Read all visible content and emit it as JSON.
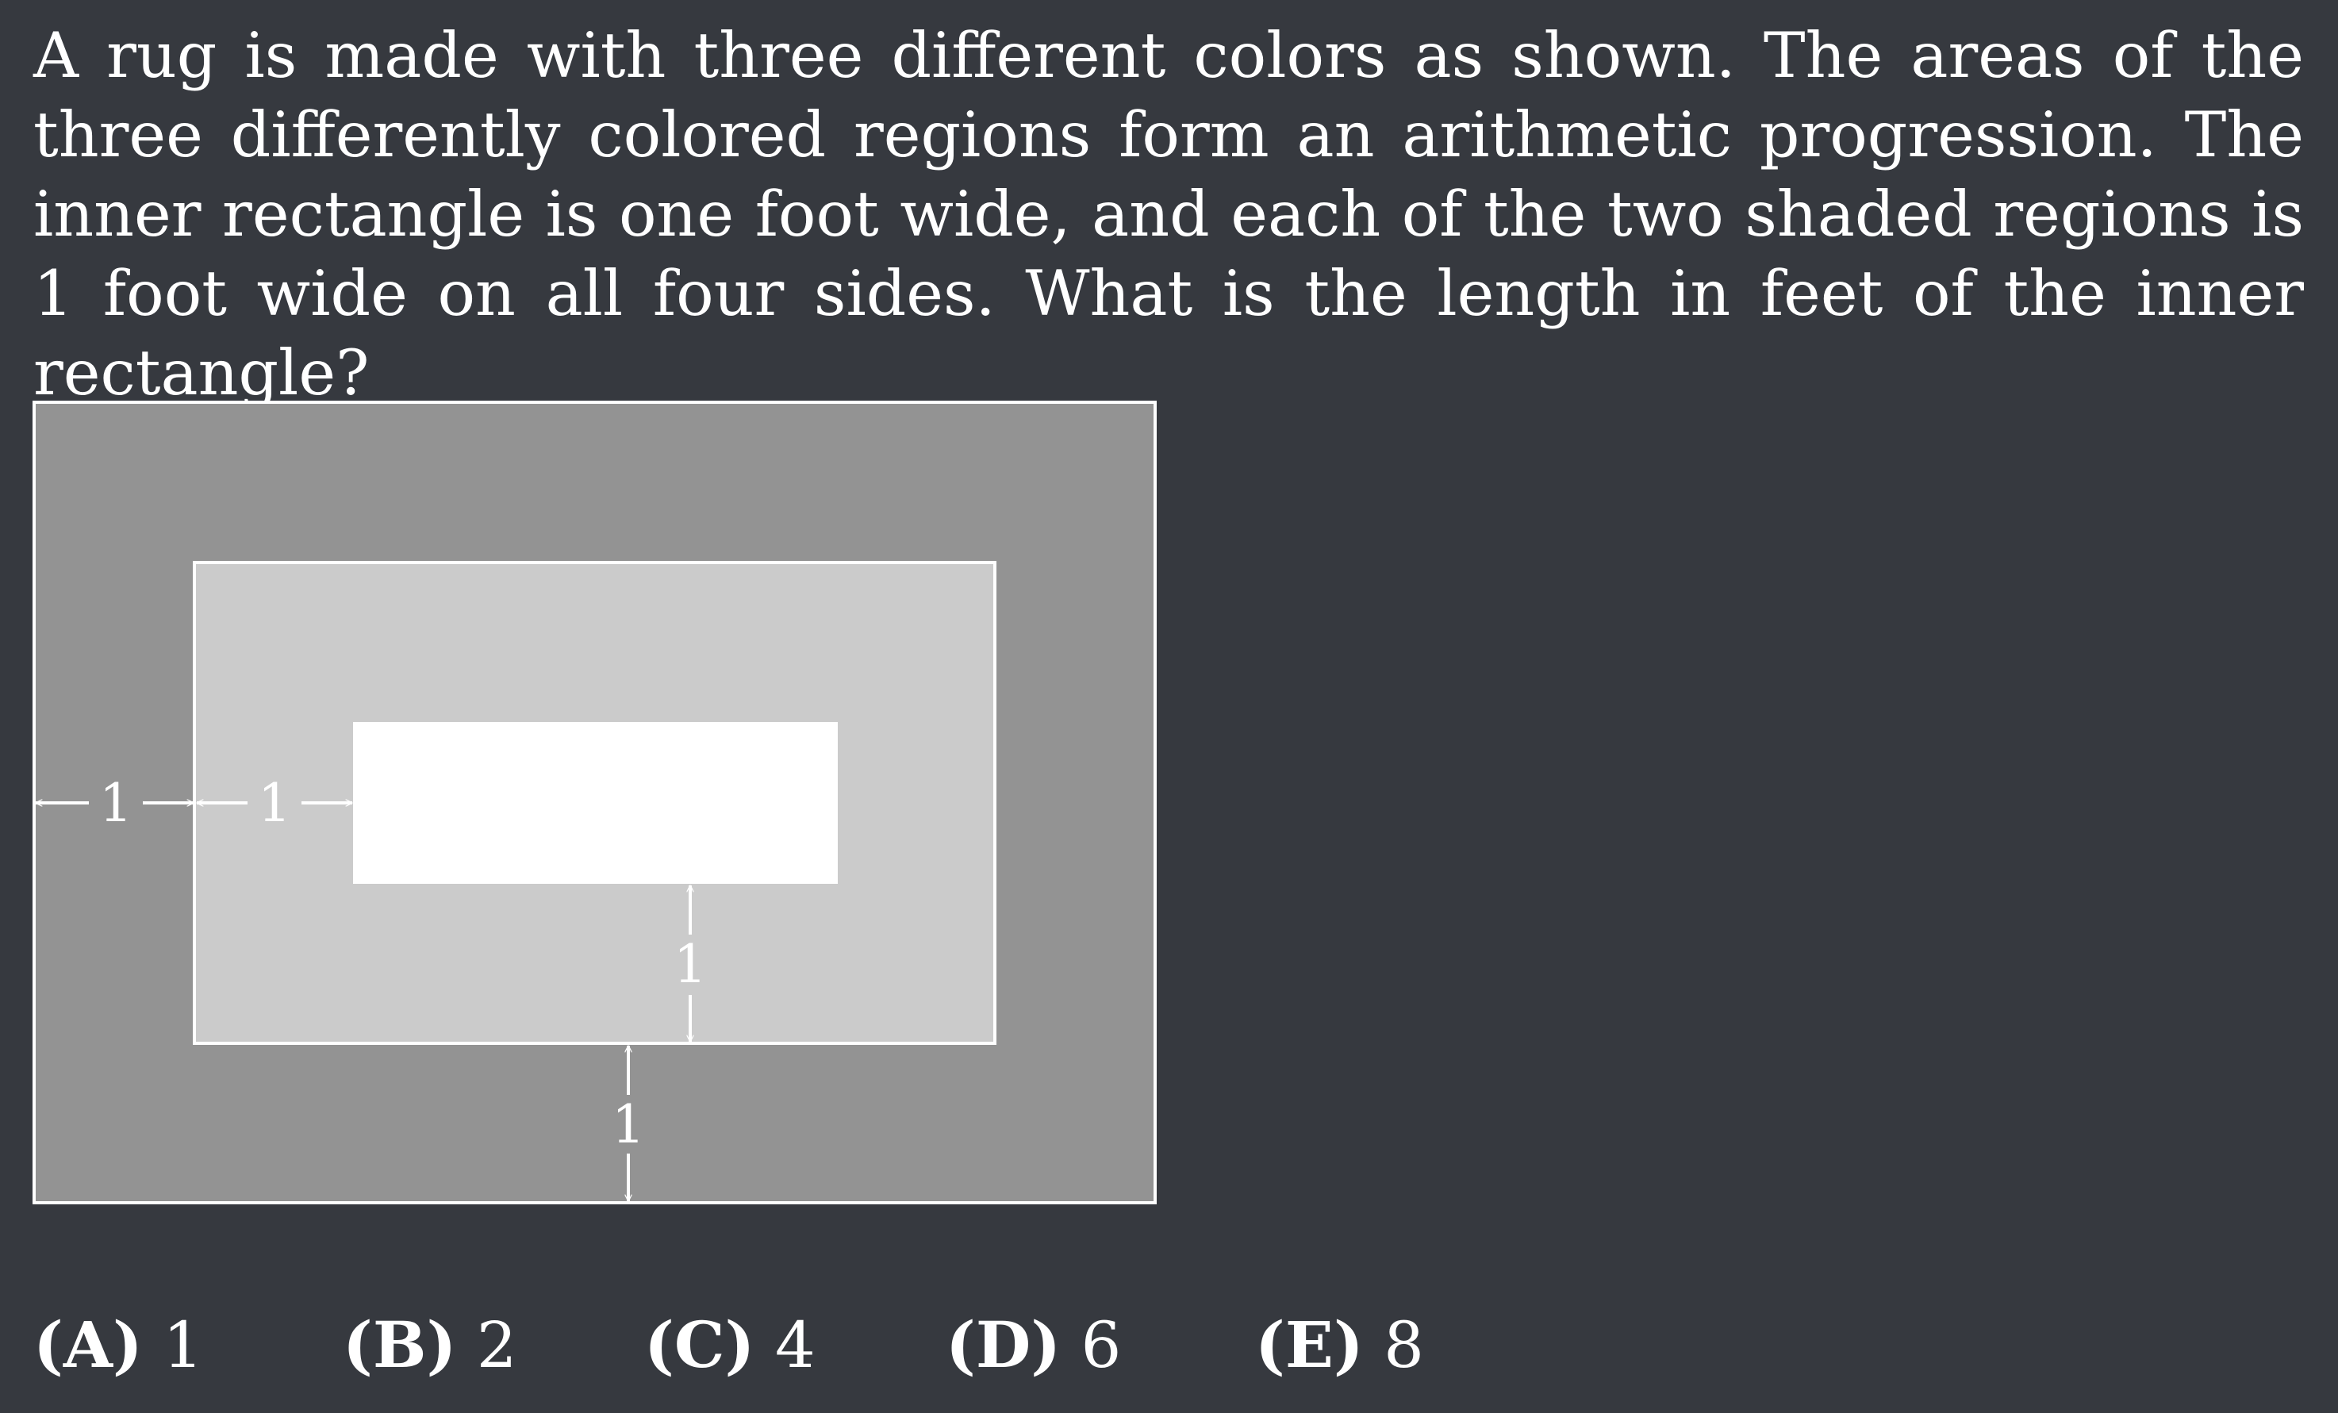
{
  "problem": {
    "text": "A rug is made with three different colors as shown. The areas of the three differently colored regions form an arithmetic progression. The inner rectangle is one foot wide, and each of the two shaded regions is 1 foot wide on all four sides. What is the length in feet of the inner rectangle?"
  },
  "diagram": {
    "labels": {
      "left_outer": "1",
      "left_inner": "1",
      "vertical_inner": "1",
      "vertical_outer": "1"
    },
    "colors": {
      "outer_region": "#939393",
      "middle_region": "#cbcbcb",
      "inner_region": "#ffffff",
      "border": "#ffffff"
    }
  },
  "choices": [
    {
      "letter": "(A)",
      "value": "1"
    },
    {
      "letter": "(B)",
      "value": "2"
    },
    {
      "letter": "(C)",
      "value": "4"
    },
    {
      "letter": "(D)",
      "value": "6"
    },
    {
      "letter": "(E)",
      "value": "8"
    }
  ]
}
